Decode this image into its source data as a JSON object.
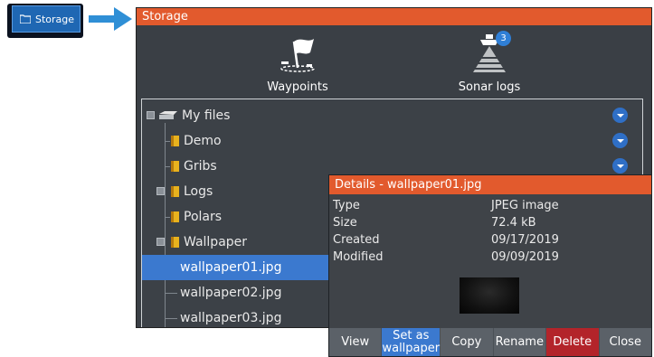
{
  "shortcut": {
    "label": "Storage",
    "icon": "folder-icon"
  },
  "window": {
    "title": "Storage",
    "icons": [
      {
        "label": "Waypoints",
        "icon": "waypoint-flag-icon"
      },
      {
        "label": "Sonar logs",
        "icon": "sonar-boat-icon",
        "badge": "3"
      }
    ]
  },
  "tree": {
    "items": [
      {
        "label": "My files",
        "icon": "drive-icon"
      },
      {
        "label": "Demo",
        "icon": "folder-icon"
      },
      {
        "label": "Gribs",
        "icon": "folder-icon"
      },
      {
        "label": "Logs",
        "icon": "folder-icon"
      },
      {
        "label": "Polars",
        "icon": "folder-icon"
      },
      {
        "label": "Wallpaper",
        "icon": "folder-icon"
      },
      {
        "label": "wallpaper01.jpg",
        "selected": true
      },
      {
        "label": "wallpaper02.jpg"
      },
      {
        "label": "wallpaper03.jpg"
      }
    ]
  },
  "details": {
    "title": "Details - wallpaper01.jpg",
    "fields": [
      {
        "key": "Type",
        "value": "JPEG image"
      },
      {
        "key": "Size",
        "value": "72.4 kB"
      },
      {
        "key": "Created",
        "value": "09/17/2019"
      },
      {
        "key": "Modified",
        "value": "09/09/2019"
      }
    ],
    "buttons": {
      "view": "View",
      "set_wallpaper": "Set as wallpaper",
      "copy": "Copy",
      "rename": "Rename",
      "delete": "Delete",
      "close": "Close"
    }
  },
  "colors": {
    "title_bar": "#e25a2d",
    "selection": "#3b79cf",
    "delete": "#b3242a"
  }
}
